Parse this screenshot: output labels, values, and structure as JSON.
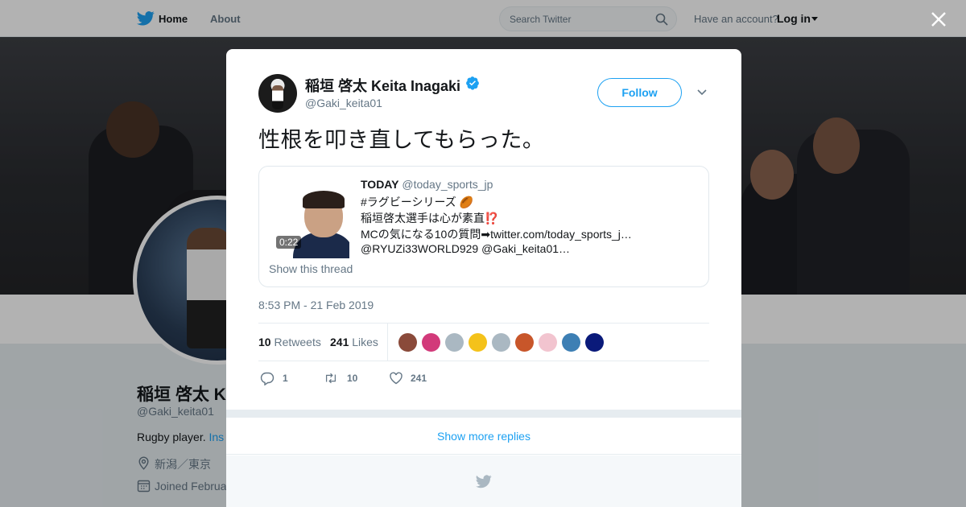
{
  "nav": {
    "home_label": "Home",
    "about_label": "About",
    "search_placeholder": "Search Twitter",
    "have_account": "Have an account?",
    "login_label": "Log in"
  },
  "profile": {
    "name": "稲垣 啓太 K",
    "handle": "@Gaki_keita01",
    "bio_text": "Rugby player. ",
    "bio_link": "Ins",
    "location": "新潟／東京",
    "joined": "Joined Februa"
  },
  "tweet": {
    "author_name": "稲垣 啓太 Keita Inagaki",
    "author_handle": "@Gaki_keita01",
    "follow_label": "Follow",
    "text": "性根を叩き直してもらった。",
    "timestamp": "8:53 PM - 21 Feb 2019",
    "retweets_count": "10",
    "retweets_label": "Retweets",
    "likes_count": "241",
    "likes_label": "Likes",
    "reply_count": "1",
    "retweet_action_count": "10",
    "like_action_count": "241"
  },
  "quote": {
    "user_name": "TODAY",
    "user_handle": "@today_sports_jp",
    "line1": "#ラグビーシリーズ 🏉",
    "line2": "稲垣啓太選手は心が素直⁉️",
    "line3": "MCの気になる10の質問➡twitter.com/today_sports_j…",
    "line4": "@RYUZi33WORLD929 @Gaki_keita01…",
    "video_duration": "0:22",
    "show_thread": "Show this thread"
  },
  "likers": [
    {
      "color": "#8a4a3a"
    },
    {
      "color": "#d23a7a"
    },
    {
      "color": "#aab8c2"
    },
    {
      "color": "#f4c21a"
    },
    {
      "color": "#aab8c2"
    },
    {
      "color": "#c8562a"
    },
    {
      "color": "#f2c4cf"
    },
    {
      "color": "#3d7fb4"
    },
    {
      "color": "#0a1a7a"
    }
  ],
  "replies": {
    "show_more": "Show more replies"
  },
  "colors": {
    "accent": "#1da1f2",
    "text": "#14171a",
    "secondary": "#657786"
  }
}
